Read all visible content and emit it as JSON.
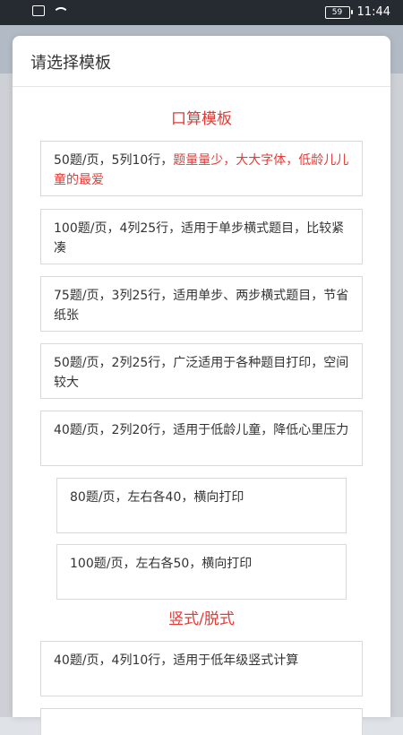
{
  "status_bar": {
    "time": "11:44",
    "battery": "59"
  },
  "modal": {
    "title": "请选择模板"
  },
  "sections": {
    "oral": {
      "title": "口算模板"
    },
    "vertical": {
      "title": "竖式/脱式"
    }
  },
  "templates": {
    "t1": {
      "text": "50题/页，5列10行，",
      "highlight": "题量量少，大大字体，低龄儿儿童的最爱"
    },
    "t2": {
      "text": "100题/页，4列25行，适用于单步横式题目，比较紧凑"
    },
    "t3": {
      "text": "75题/页，3列25行，适用单步、两步横式题目，节省纸张"
    },
    "t4": {
      "text": "50题/页，2列25行，广泛适用于各种题目打印，空间较大"
    },
    "t5": {
      "text": "40题/页，2列20行，适用于低龄儿童，降低心里压力"
    },
    "t6": {
      "text": "80题/页，左右各40，横向打印"
    },
    "t7": {
      "text": "100题/页，左右各50，横向打印"
    },
    "v1": {
      "text": "40题/页，4列10行，适用于低年级竖式计算"
    }
  }
}
